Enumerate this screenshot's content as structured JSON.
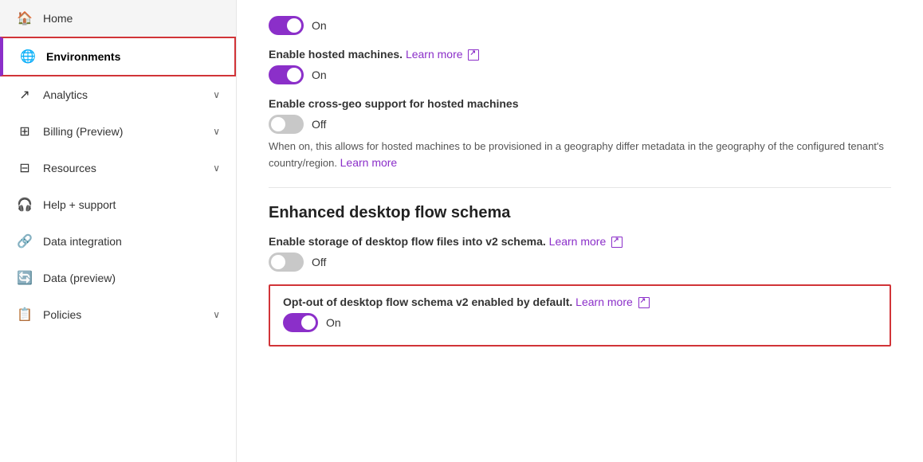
{
  "sidebar": {
    "items": [
      {
        "id": "home",
        "label": "Home",
        "icon": "🏠",
        "active": false,
        "hasChevron": false
      },
      {
        "id": "environments",
        "label": "Environments",
        "icon": "🌐",
        "active": true,
        "hasChevron": false
      },
      {
        "id": "analytics",
        "label": "Analytics",
        "icon": "📈",
        "active": false,
        "hasChevron": true
      },
      {
        "id": "billing",
        "label": "Billing (Preview)",
        "icon": "⊞",
        "active": false,
        "hasChevron": true
      },
      {
        "id": "resources",
        "label": "Resources",
        "icon": "⊟",
        "active": false,
        "hasChevron": true
      },
      {
        "id": "help",
        "label": "Help + support",
        "icon": "🎧",
        "active": false,
        "hasChevron": false
      },
      {
        "id": "data-integration",
        "label": "Data integration",
        "icon": "🔗",
        "active": false,
        "hasChevron": false
      },
      {
        "id": "data-preview",
        "label": "Data (preview)",
        "icon": "🔄",
        "active": false,
        "hasChevron": false
      },
      {
        "id": "policies",
        "label": "Policies",
        "icon": "📋",
        "active": false,
        "hasChevron": true
      }
    ]
  },
  "main": {
    "top_toggle": {
      "state": "on",
      "status_label": "On"
    },
    "hosted_machines": {
      "label": "Enable hosted machines.",
      "learn_more": "Learn more",
      "toggle_state": "on",
      "status_label": "On"
    },
    "cross_geo": {
      "label": "Enable cross-geo support for hosted machines",
      "toggle_state": "off",
      "status_label": "Off",
      "description": "When on, this allows for hosted machines to be provisioned in a geography differ metadata in the geography of the configured tenant's country/region.",
      "learn_more": "Learn more"
    },
    "desktop_flow_section": {
      "title": "Enhanced desktop flow schema",
      "storage": {
        "label": "Enable storage of desktop flow files into v2 schema.",
        "learn_more": "Learn more",
        "toggle_state": "off",
        "status_label": "Off"
      },
      "opt_out": {
        "label": "Opt-out of desktop flow schema v2 enabled by default.",
        "learn_more": "Learn more",
        "toggle_state": "on",
        "status_label": "On"
      }
    }
  }
}
